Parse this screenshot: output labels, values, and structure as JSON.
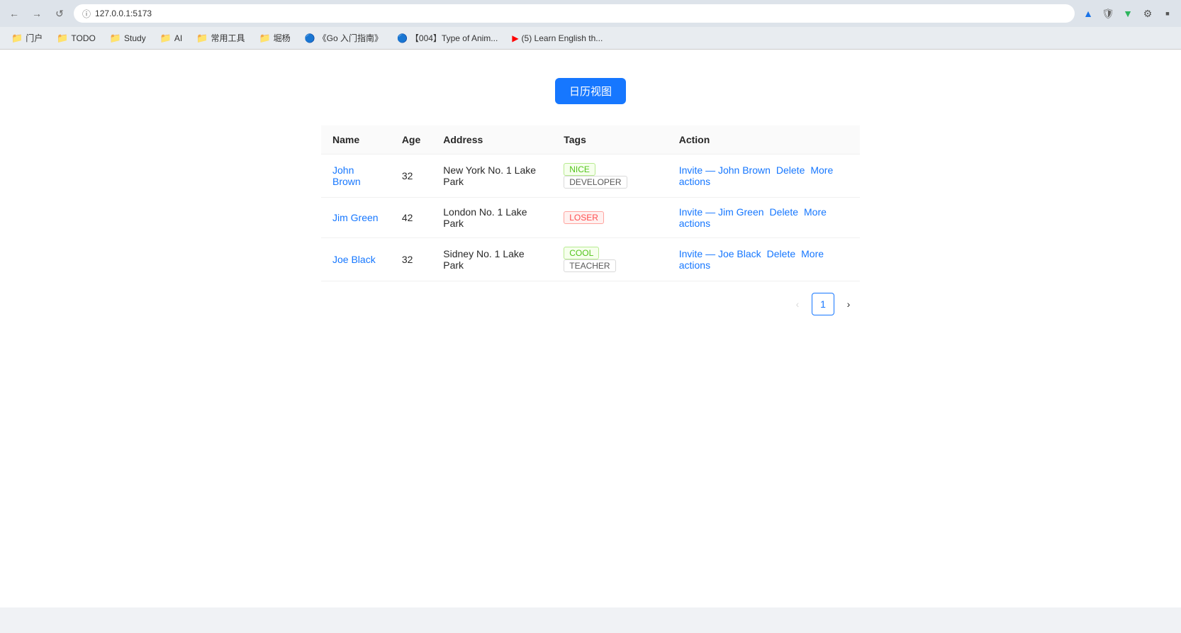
{
  "browser": {
    "address": "127.0.0.1:5173",
    "tabs": [
      {
        "id": "tab-1",
        "label": "门户",
        "icon": "folder"
      },
      {
        "id": "tab-2",
        "label": "TODO",
        "icon": "folder"
      },
      {
        "id": "tab-3",
        "label": "Study",
        "icon": "folder"
      },
      {
        "id": "tab-4",
        "label": "AI",
        "icon": "folder"
      },
      {
        "id": "tab-5",
        "label": "常用工具",
        "icon": "folder"
      },
      {
        "id": "tab-6",
        "label": "堀杨",
        "icon": "folder"
      },
      {
        "id": "tab-7",
        "label": "《Go 入门指南》",
        "icon": "page"
      },
      {
        "id": "tab-8",
        "label": "【004】Type of Anim...",
        "icon": "page"
      },
      {
        "id": "tab-9",
        "label": "(5) Learn English th...",
        "icon": "youtube"
      }
    ]
  },
  "calendar_button_label": "日历视图",
  "table": {
    "headers": [
      {
        "key": "name",
        "label": "Name"
      },
      {
        "key": "age",
        "label": "Age"
      },
      {
        "key": "address",
        "label": "Address"
      },
      {
        "key": "tags",
        "label": "Tags"
      },
      {
        "key": "action",
        "label": "Action"
      }
    ],
    "rows": [
      {
        "name": "John Brown",
        "age": "32",
        "address": "New York No. 1 Lake Park",
        "tags": [
          "NICE",
          "DEVELOPER"
        ],
        "tag_classes": [
          "nice",
          "developer"
        ],
        "invite_label": "Invite — John Brown",
        "delete_label": "Delete",
        "more_label": "More actions"
      },
      {
        "name": "Jim Green",
        "age": "42",
        "address": "London No. 1 Lake Park",
        "tags": [
          "LOSER"
        ],
        "tag_classes": [
          "loser"
        ],
        "invite_label": "Invite — Jim Green",
        "delete_label": "Delete",
        "more_label": "More actions"
      },
      {
        "name": "Joe Black",
        "age": "32",
        "address": "Sidney No. 1 Lake Park",
        "tags": [
          "COOL",
          "TEACHER"
        ],
        "tag_classes": [
          "cool",
          "teacher"
        ],
        "invite_label": "Invite — Joe Black",
        "delete_label": "Delete",
        "more_label": "More actions"
      }
    ]
  },
  "pagination": {
    "current_page": 1,
    "prev_label": "‹",
    "next_label": "›"
  }
}
